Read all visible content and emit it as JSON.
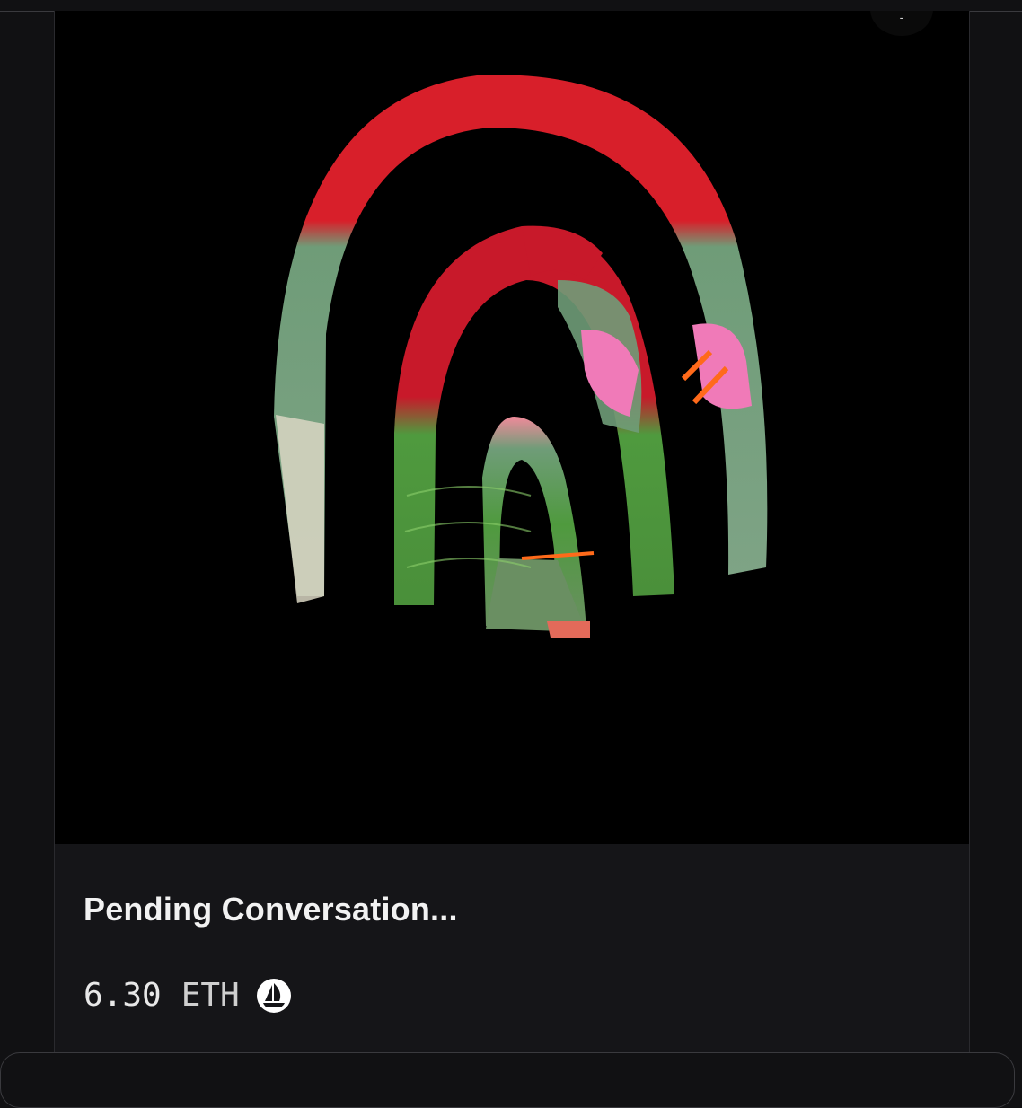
{
  "card": {
    "title": "Pending Conversation...",
    "price_amount": "6.30",
    "price_currency": "ETH",
    "marketplace_icon": "opensea-boat-icon",
    "artwork_icon": "rainbow-arch-artwork",
    "corner_button_label": "-"
  },
  "colors": {
    "page_background": "#111113",
    "card_background": "#151518",
    "media_background": "#000000",
    "arch_red": "#d81f2a",
    "arch_green": "#6f9c78",
    "arch_pink": "#f07ab8",
    "arch_lime": "#4f9a3e",
    "arch_cream": "#d9d6c3"
  }
}
